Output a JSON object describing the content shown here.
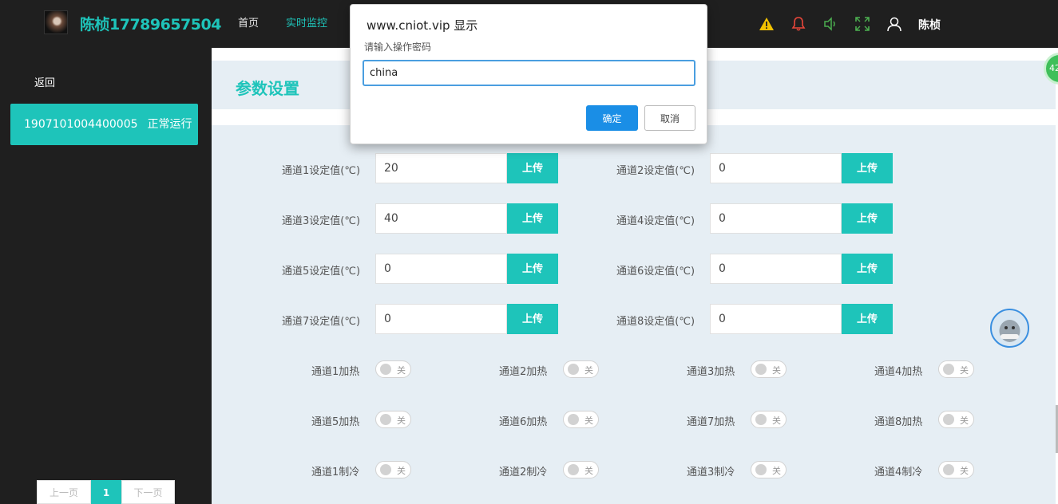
{
  "header": {
    "username": "陈桢17789657504",
    "nav": [
      "首页",
      "实时监控"
    ],
    "active_nav_index": 1,
    "user_name": "陈桢",
    "icons": [
      "warning-icon",
      "bell-icon",
      "speaker-icon",
      "fullscreen-icon",
      "user-icon"
    ],
    "colors": {
      "warning": "#f2c200",
      "bell": "#e8463a",
      "speaker": "#4caf50",
      "fullscreen": "#4caf50"
    }
  },
  "sidebar": {
    "back_label": "返回",
    "device": {
      "id": "1907101004400005",
      "status": "正常运行"
    },
    "pagination": {
      "prev": "上一页",
      "current": "1",
      "next": "下一页"
    }
  },
  "main": {
    "title": "参数设置",
    "upload_label": "上传",
    "setpoints": [
      {
        "label": "通道1设定值(℃)",
        "value": "20"
      },
      {
        "label": "通道2设定值(℃)",
        "value": "0"
      },
      {
        "label": "通道3设定值(℃)",
        "value": "40"
      },
      {
        "label": "通道4设定值(℃)",
        "value": "0"
      },
      {
        "label": "通道5设定值(℃)",
        "value": "0"
      },
      {
        "label": "通道6设定值(℃)",
        "value": "0"
      },
      {
        "label": "通道7设定值(℃)",
        "value": "0"
      },
      {
        "label": "通道8设定值(℃)",
        "value": "0"
      }
    ],
    "switches": [
      {
        "label": "通道1加热",
        "state": "关"
      },
      {
        "label": "通道2加热",
        "state": "关"
      },
      {
        "label": "通道3加热",
        "state": "关"
      },
      {
        "label": "通道4加热",
        "state": "关"
      },
      {
        "label": "通道5加热",
        "state": "关"
      },
      {
        "label": "通道6加热",
        "state": "关"
      },
      {
        "label": "通道7加热",
        "state": "关"
      },
      {
        "label": "通道8加热",
        "state": "关"
      },
      {
        "label": "通道1制冷",
        "state": "关"
      },
      {
        "label": "通道2制冷",
        "state": "关"
      },
      {
        "label": "通道3制冷",
        "state": "关"
      },
      {
        "label": "通道4制冷",
        "state": "关"
      }
    ]
  },
  "dialog": {
    "title": "www.cniot.vip 显示",
    "message": "请输入操作密码",
    "input_value": "china",
    "ok_label": "确定",
    "cancel_label": "取消"
  },
  "floating": {
    "badge_text": "42"
  },
  "colors": {
    "accent": "#1ec4ba",
    "dark": "#1f1f1f",
    "panel": "#e6eef4",
    "dialog_ok": "#1a8ee6"
  }
}
